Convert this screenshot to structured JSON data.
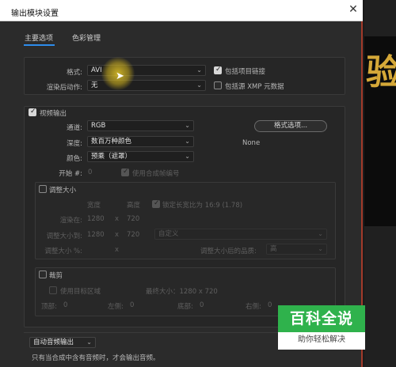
{
  "dialog": {
    "title": "输出模块设置",
    "close_icon": "✕"
  },
  "tabs": [
    {
      "label": "主要选项",
      "active": true
    },
    {
      "label": "色彩管理",
      "active": false
    }
  ],
  "main": {
    "format_label": "格式:",
    "format_value": "AVI",
    "post_render_label": "渲染后动作:",
    "post_render_value": "无",
    "include_project_link": "包括项目链接",
    "include_xmp": "包括源 XMP 元数据"
  },
  "video": {
    "section_label": "视频输出",
    "channels_label": "通道:",
    "channels_value": "RGB",
    "depth_label": "深度:",
    "depth_value": "数百万种颜色",
    "color_label": "颜色:",
    "color_value": "预乘（遮罩）",
    "start_label": "开始 #:",
    "start_value": "0",
    "use_comp_frame": "使用合成帧编号",
    "format_options_button": "格式选项...",
    "format_options_value": "None"
  },
  "resize": {
    "section_label": "调整大小",
    "width_header": "宽度",
    "height_header": "高度",
    "lock_aspect": "锁定长宽比为 16:9 (1.78)",
    "render_at_label": "渲染在:",
    "render_at_w": "1280",
    "render_at_x": "x",
    "render_at_h": "720",
    "resize_to_label": "调整大小到:",
    "resize_to_w": "1280",
    "resize_to_x": "x",
    "resize_to_h": "720",
    "preset_value": "自定义",
    "resize_pct_label": "调整大小 %:",
    "resize_pct_x": "x",
    "quality_label": "调整大小后的品质:",
    "quality_value": "高"
  },
  "crop": {
    "section_label": "裁剪",
    "use_roi": "使用目标区域",
    "final_size": "最终大小：1280 x 720",
    "top_label": "顶部:",
    "top_value": "0",
    "left_label": "左侧:",
    "left_value": "0",
    "bottom_label": "底部:",
    "bottom_value": "0",
    "right_label": "右侧:",
    "right_value": "0"
  },
  "audio": {
    "mode_value": "自动音频输出",
    "note": "只有当合成中含有音频时，才会输出音频。"
  },
  "background": {
    "glyph": "验"
  },
  "watermark": {
    "top": "百科全说",
    "bottom": "助你轻松解决"
  },
  "colors": {
    "accent": "#2d8ceb",
    "cursor_highlight": "#e6c828",
    "watermark_green": "#2fb24c"
  }
}
